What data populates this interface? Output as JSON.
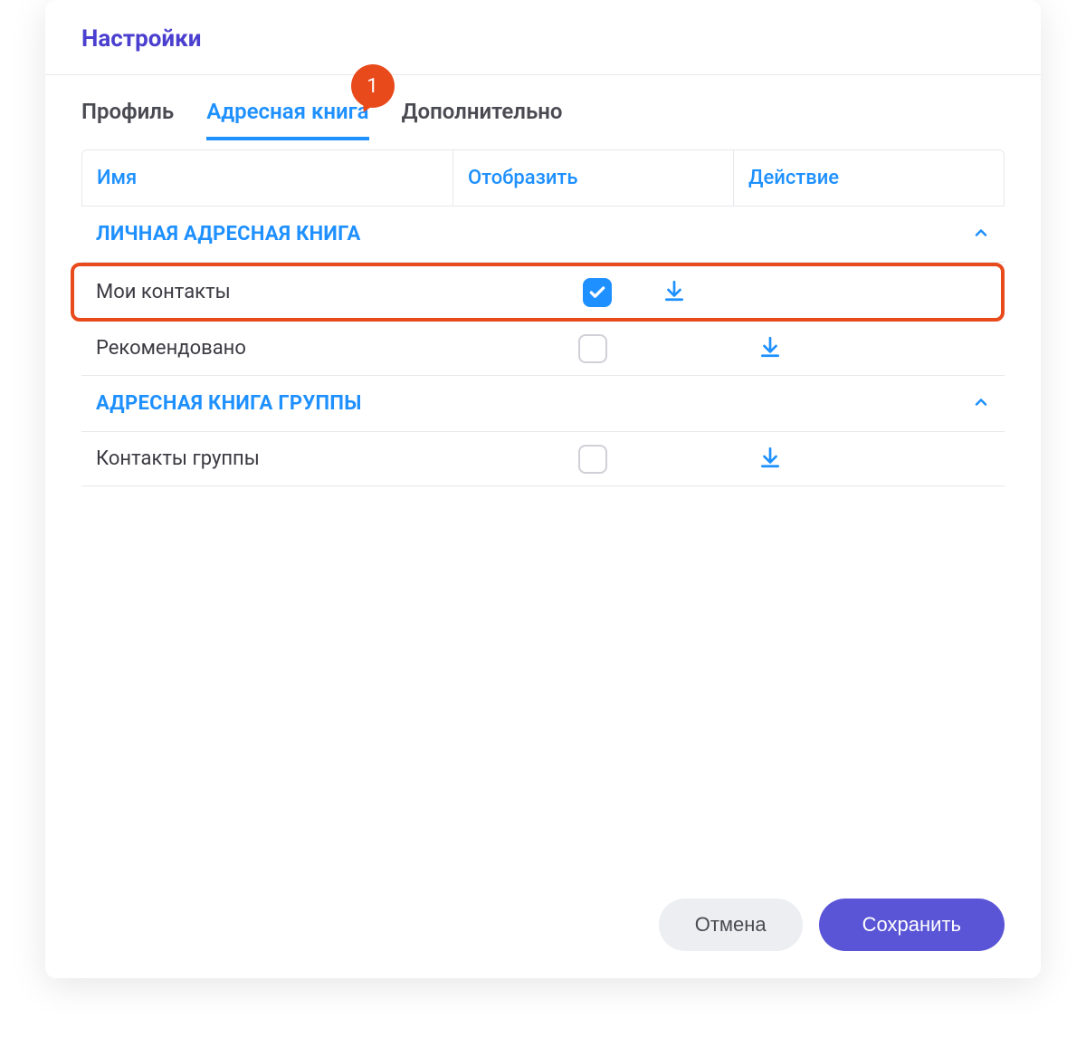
{
  "header": {
    "title": "Настройки"
  },
  "tabs": {
    "profile": "Профиль",
    "address_book": "Адресная книга",
    "additional": "Дополнительно",
    "badge": "1"
  },
  "columns": {
    "name": "Имя",
    "display": "Отобразить",
    "action": "Действие"
  },
  "sections": [
    {
      "title": "ЛИЧНАЯ АДРЕСНАЯ КНИГА",
      "rows": [
        {
          "name": "Мои контакты",
          "checked": true,
          "highlighted": true
        },
        {
          "name": "Рекомендовано",
          "checked": false,
          "highlighted": false
        }
      ]
    },
    {
      "title": "АДРЕСНАЯ КНИГА ГРУППЫ",
      "rows": [
        {
          "name": "Контакты группы",
          "checked": false,
          "highlighted": false
        }
      ]
    }
  ],
  "footer": {
    "cancel": "Отмена",
    "save": "Сохранить"
  }
}
